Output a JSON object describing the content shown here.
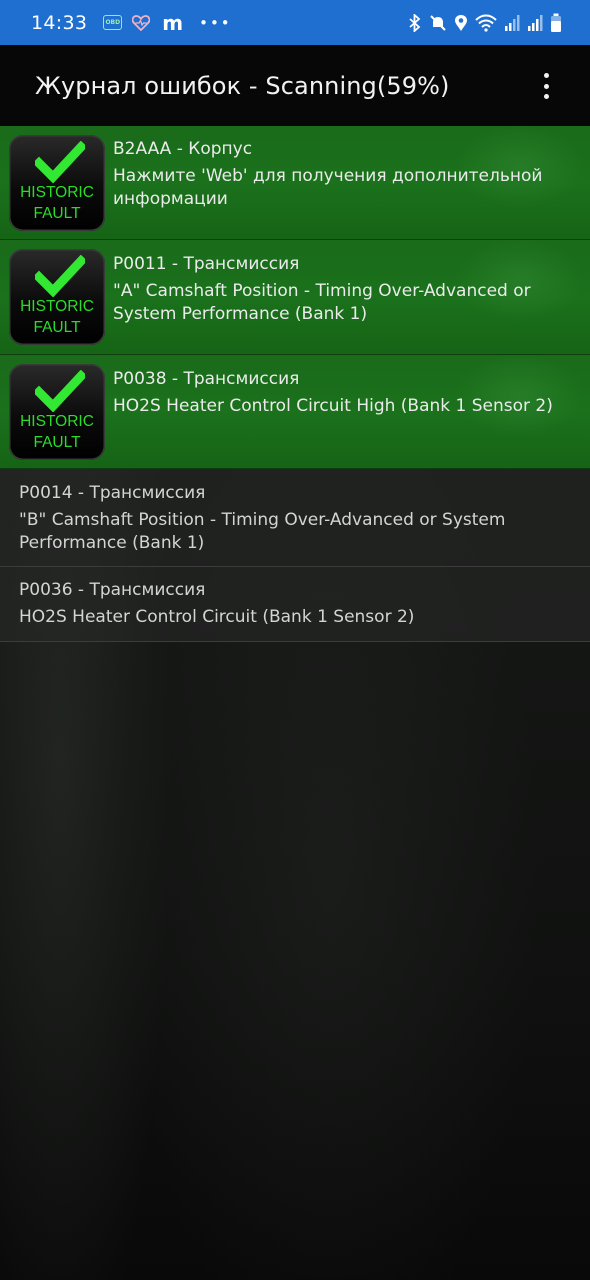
{
  "status_bar": {
    "time": "14:33",
    "left_icons": [
      "obd-icon",
      "heart-icon",
      "m-icon",
      "more-dots-icon"
    ],
    "obd_label": "OBD",
    "m_label": "m",
    "dots": "•••",
    "right_icons": [
      "bluetooth-icon",
      "mute-icon",
      "location-icon",
      "wifi-icon",
      "signal-icon",
      "signal-icon-2",
      "battery-icon"
    ],
    "color": "#1e6fd0"
  },
  "app_bar": {
    "title": "Журнал ошибок - Scanning(59%)",
    "menu_icon": "overflow-menu-icon"
  },
  "faults": [
    {
      "code_title": "B2AAA - Корпус",
      "description": "Нажмите 'Web' для получения дополнительной информации",
      "historic": true,
      "badge_line1": "HISTORIC",
      "badge_line2": "FAULT"
    },
    {
      "code_title": "P0011 - Трансмиссия",
      "description": "\"A\" Camshaft Position - Timing Over-Advanced or System Performance (Bank 1)",
      "historic": true,
      "badge_line1": "HISTORIC",
      "badge_line2": "FAULT"
    },
    {
      "code_title": "P0038 - Трансмиссия",
      "description": "HO2S Heater Control Circuit High (Bank 1 Sensor 2)",
      "historic": true,
      "badge_line1": "HISTORIC",
      "badge_line2": "FAULT"
    },
    {
      "code_title": "P0014 - Трансмиссия",
      "description": "\"B\" Camshaft Position - Timing Over-Advanced or System Performance (Bank 1)",
      "historic": false
    },
    {
      "code_title": "P0036 - Трансмиссия",
      "description": "HO2S Heater Control Circuit (Bank 1 Sensor 2)",
      "historic": false
    }
  ],
  "colors": {
    "historic_row": "#1b711c",
    "badge_text": "#2bdc2b",
    "check_mark": "#33e833"
  }
}
